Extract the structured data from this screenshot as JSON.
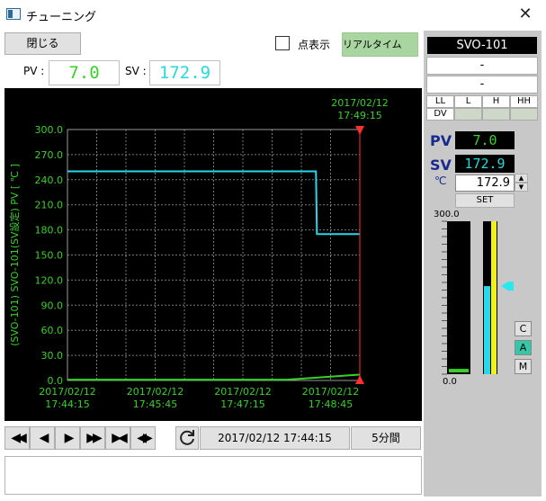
{
  "window": {
    "title": "チューニング",
    "close_glyph": "✕"
  },
  "toolbar": {
    "close_label": "閉じる",
    "dots_label": "点表示",
    "dots_checked": false,
    "realtime_label": "リアルタイム"
  },
  "readout": {
    "pv_label": "PV :",
    "pv_value": "7.0",
    "sv_label": "SV :",
    "sv_value": "172.9"
  },
  "chart_data": {
    "type": "line",
    "title": "",
    "ylabel": "(SVO-101) SVO-101(SV設定) PV [ ℃ ]",
    "xlabel": "",
    "ylim": [
      0,
      300
    ],
    "yticks": [
      "300.0",
      "270.0",
      "240.0",
      "210.0",
      "180.0",
      "150.0",
      "120.0",
      "90.0",
      "60.0",
      "30.0",
      "0.0"
    ],
    "xticks": [
      {
        "date": "2017/02/12",
        "time": "17:44:15"
      },
      {
        "date": "2017/02/12",
        "time": "17:45:45"
      },
      {
        "date": "2017/02/12",
        "time": "17:47:15"
      },
      {
        "date": "2017/02/12",
        "time": "17:48:45"
      }
    ],
    "cursor": {
      "date": "2017/02/12",
      "time": "17:49:15",
      "color": "#ff3030"
    },
    "grid": true,
    "series": [
      {
        "color": "#28d8e8",
        "x": [
          "17:44:15",
          "17:48:30",
          "17:48:31",
          "17:49:15"
        ],
        "y": [
          250,
          250,
          175,
          175
        ]
      },
      {
        "color": "#3ad02a",
        "x": [
          "17:44:15",
          "17:48:00",
          "17:49:15"
        ],
        "y": [
          1,
          1,
          7
        ]
      }
    ]
  },
  "nav": {
    "buttons": [
      {
        "name": "first-button",
        "glyph": "◀◀"
      },
      {
        "name": "prev-button",
        "glyph": "◀"
      },
      {
        "name": "next-button",
        "glyph": "▶"
      },
      {
        "name": "last-button",
        "glyph": "▶▶"
      },
      {
        "name": "zoom-in-button",
        "glyph": "▶◀"
      },
      {
        "name": "zoom-out-button",
        "glyph": "◀▶"
      }
    ],
    "refresh_icon": "refresh-icon",
    "datetime": "2017/02/12 17:44:15",
    "span": "5分間"
  },
  "side": {
    "tag": "SVO-101",
    "dash1": "-",
    "dash2": "-",
    "alarms": [
      "LL",
      "L",
      "H",
      "HH"
    ],
    "dv_label": "DV",
    "pv_label": "PV",
    "pv_value": "7.0",
    "sv_label": "SV",
    "sv_value": "172.9",
    "unit": "℃",
    "sv_input": "172.9",
    "set_label": "SET",
    "bar_max": "300.0",
    "bar_min": "0.0",
    "pv_bar_fraction": 0.023,
    "sv_bar_fraction": 0.576,
    "mv_bar_fraction": 1.0,
    "modes": [
      "C",
      "A",
      "M"
    ],
    "active_mode": "A"
  }
}
